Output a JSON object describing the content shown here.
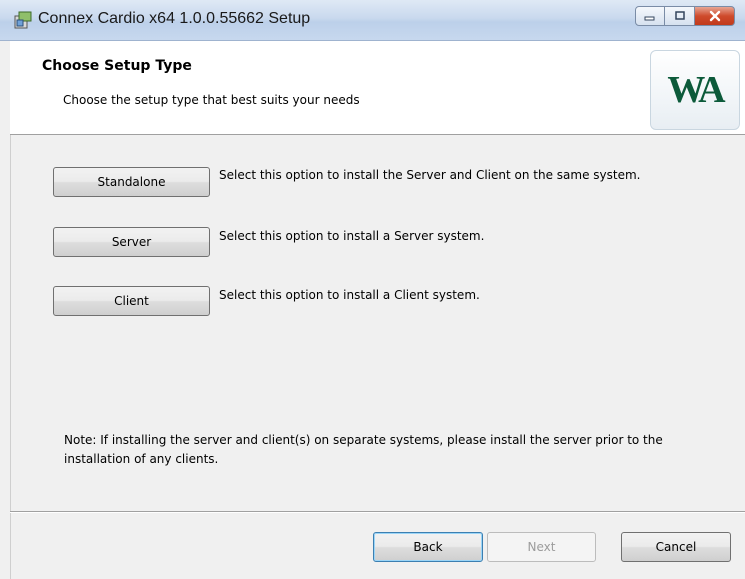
{
  "window": {
    "title": "Connex Cardio x64 1.0.0.55662 Setup",
    "controls": {
      "minimize_icon": "minimize-icon",
      "maximize_icon": "maximize-icon",
      "close_icon": "close-icon"
    }
  },
  "header": {
    "title": "Choose Setup Type",
    "subtitle": "Choose the setup type that best suits your needs",
    "logo_text": "WA"
  },
  "options": [
    {
      "label": "Standalone",
      "description": "Select this option to install the Server and Client on the same system."
    },
    {
      "label": "Server",
      "description": "Select this option to install a Server system."
    },
    {
      "label": "Client",
      "description": "Select this option to install a Client system."
    }
  ],
  "note": "Note: If installing the server and client(s) on separate systems, please install the server prior to the installation of any clients.",
  "footer": {
    "back_label": "Back",
    "next_label": "Next",
    "cancel_label": "Cancel"
  },
  "colors": {
    "logo_green": "#0c5a3a",
    "close_red": "#c13a1b",
    "default_button_border": "#3c7fb1"
  }
}
